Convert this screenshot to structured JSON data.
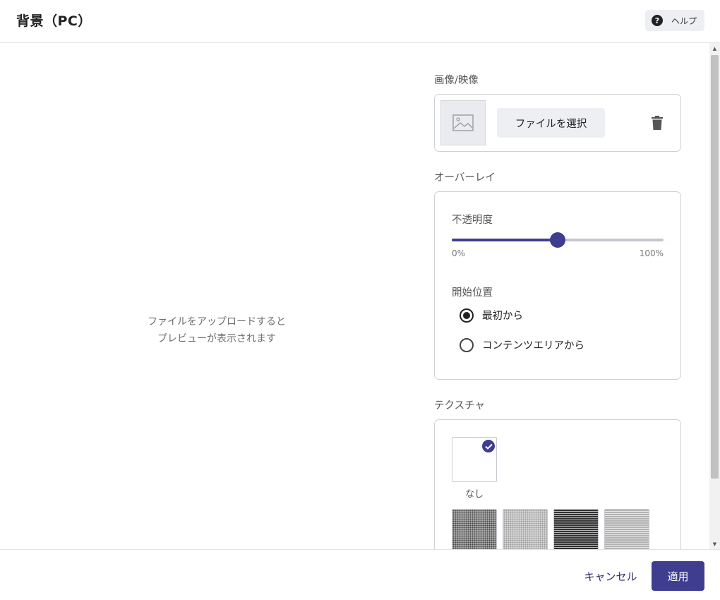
{
  "header": {
    "title": "背景（PC）",
    "help_label": "ヘルプ",
    "help_icon": "?"
  },
  "preview": {
    "line1": "ファイルをアップロードすると",
    "line2": "プレビューが表示されます"
  },
  "media": {
    "label": "画像/映像",
    "select_file_label": "ファイルを選択"
  },
  "overlay": {
    "label": "オーバーレイ",
    "opacity_label": "不透明度",
    "opacity_value": 0.5,
    "min_label": "0%",
    "max_label": "100%",
    "start_position_label": "開始位置",
    "options": [
      {
        "label": "最初から",
        "checked": true
      },
      {
        "label": "コンテンツエリアから",
        "checked": false
      }
    ]
  },
  "texture": {
    "label": "テクスチャ",
    "none_label": "なし",
    "selected": "none"
  },
  "footer": {
    "cancel_label": "キャンセル",
    "apply_label": "適用"
  },
  "colors": {
    "accent": "#3f3d8f",
    "border": "#cfd0d5",
    "button_bg": "#eeeff2"
  }
}
